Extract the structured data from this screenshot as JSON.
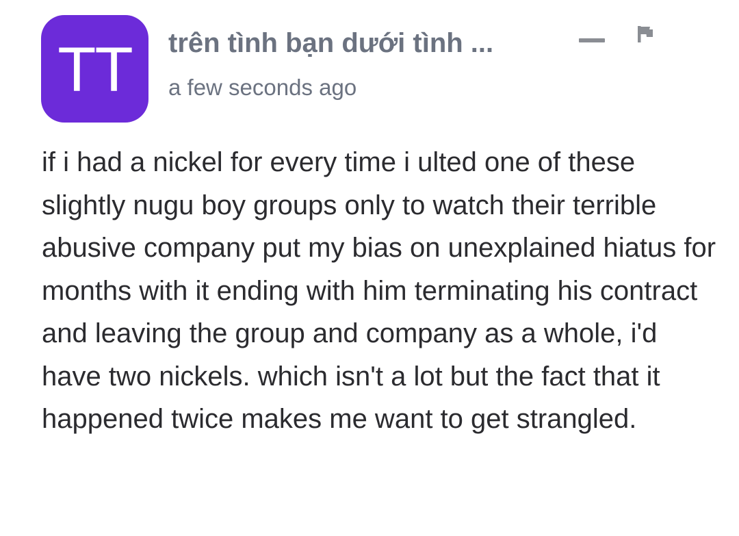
{
  "comment": {
    "avatar_initials": "TT",
    "author_name": "trên tình bạn dưới tình ...",
    "timestamp": "a few seconds ago",
    "body": "if i had a nickel for every time i ulted one of these slightly nugu boy groups only to watch their terrible abusive company put my bias on unexplained hiatus for months with it ending with him terminating his contract and leaving the group and company as a whole, i'd have two nickels. which isn't a lot but the fact that it happened twice makes me want to get strangled.",
    "actions": {
      "collapse_icon": "minus-icon",
      "report_icon": "flag-icon"
    }
  },
  "colors": {
    "avatar_bg": "#6c2bd9",
    "meta_text": "#6b7280",
    "body_text": "#2b2b2f",
    "icon": "#8a8d93"
  }
}
